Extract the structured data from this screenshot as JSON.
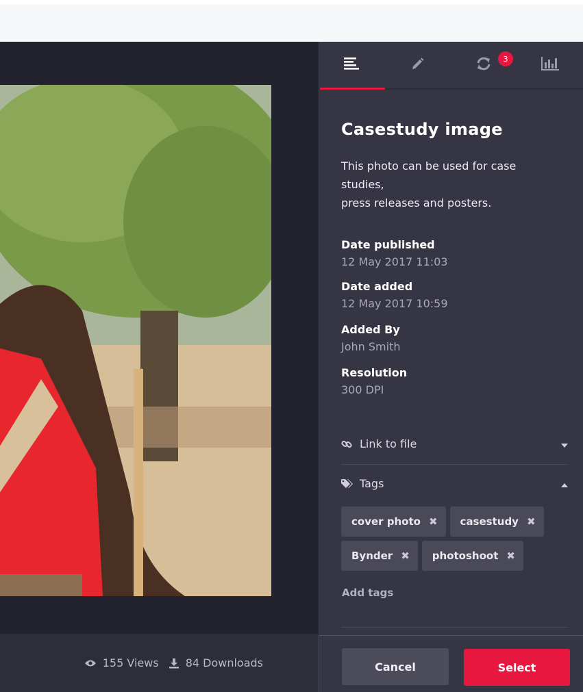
{
  "tabs": [
    {
      "name": "details",
      "icon": "align-left-icon"
    },
    {
      "name": "edit",
      "icon": "pencil-icon"
    },
    {
      "name": "versions",
      "icon": "refresh-icon",
      "badge": "3"
    },
    {
      "name": "stats",
      "icon": "bar-chart-icon"
    }
  ],
  "asset": {
    "title": "Casestudy image",
    "description_line1": "This photo can be used for case studies,",
    "description_line2": "press releases and posters."
  },
  "fields": {
    "date_published": {
      "label": "Date published",
      "value": "12 May  2017 11:03"
    },
    "date_added": {
      "label": "Date added",
      "value": "12 May  2017 10:59"
    },
    "added_by": {
      "label": "Added By",
      "value": "John Smith"
    },
    "resolution": {
      "label": "Resolution",
      "value": "300 DPI"
    }
  },
  "sections": {
    "link_to_file": "Link to file",
    "tags": "Tags"
  },
  "tags": [
    "cover photo",
    "casestudy",
    "Bynder",
    "photoshoot"
  ],
  "add_tags_placeholder": "Add tags",
  "stats": {
    "views": "155 Views",
    "downloads": "84 Downloads"
  },
  "buttons": {
    "cancel": "Cancel",
    "select": "Select"
  },
  "colors": {
    "accent": "#e8173f",
    "panel": "#363544",
    "viewer": "#23232f"
  }
}
